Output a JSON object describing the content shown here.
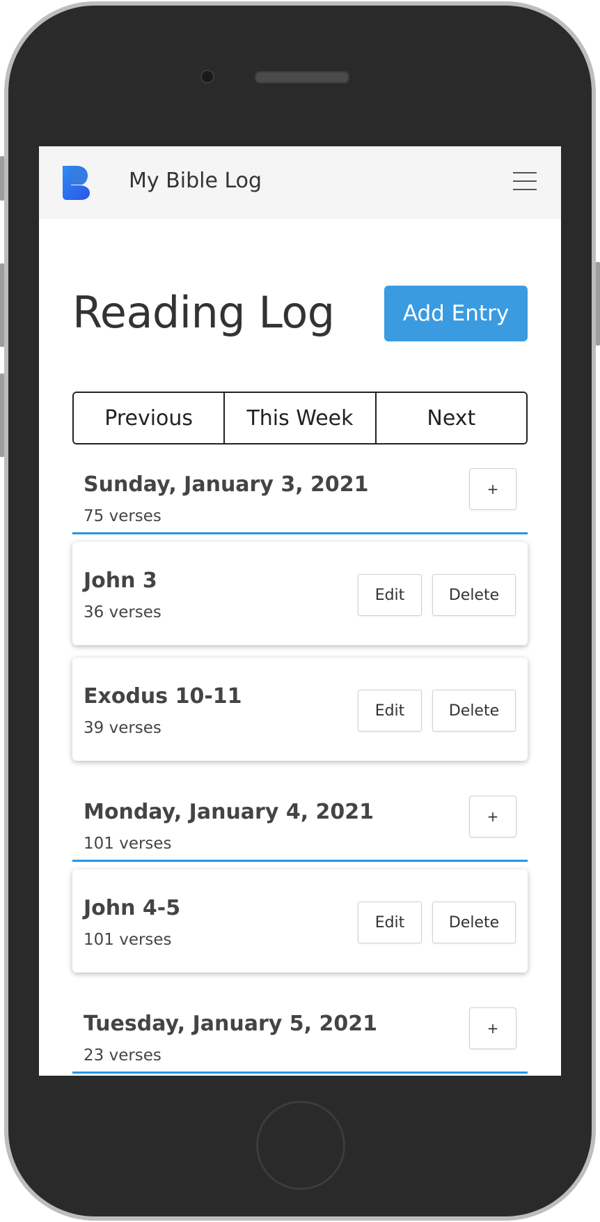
{
  "app": {
    "brand": "My Bible Log",
    "logo_letter": "B",
    "accent": "#3a9be0"
  },
  "page": {
    "title": "Reading Log",
    "add_entry_label": "Add Entry"
  },
  "week_nav": {
    "previous": "Previous",
    "this_week": "This Week",
    "next": "Next"
  },
  "days": [
    {
      "date": "Sunday, January 3, 2021",
      "count": "75 verses",
      "add_label": "+",
      "entries": [
        {
          "title": "John 3",
          "count": "36 verses",
          "edit": "Edit",
          "delete": "Delete"
        },
        {
          "title": "Exodus 10-11",
          "count": "39 verses",
          "edit": "Edit",
          "delete": "Delete"
        }
      ]
    },
    {
      "date": "Monday, January 4, 2021",
      "count": "101 verses",
      "add_label": "+",
      "entries": [
        {
          "title": "John 4-5",
          "count": "101 verses",
          "edit": "Edit",
          "delete": "Delete"
        }
      ]
    },
    {
      "date": "Tuesday, January 5, 2021",
      "count": "23 verses",
      "add_label": "+",
      "entries": []
    }
  ]
}
